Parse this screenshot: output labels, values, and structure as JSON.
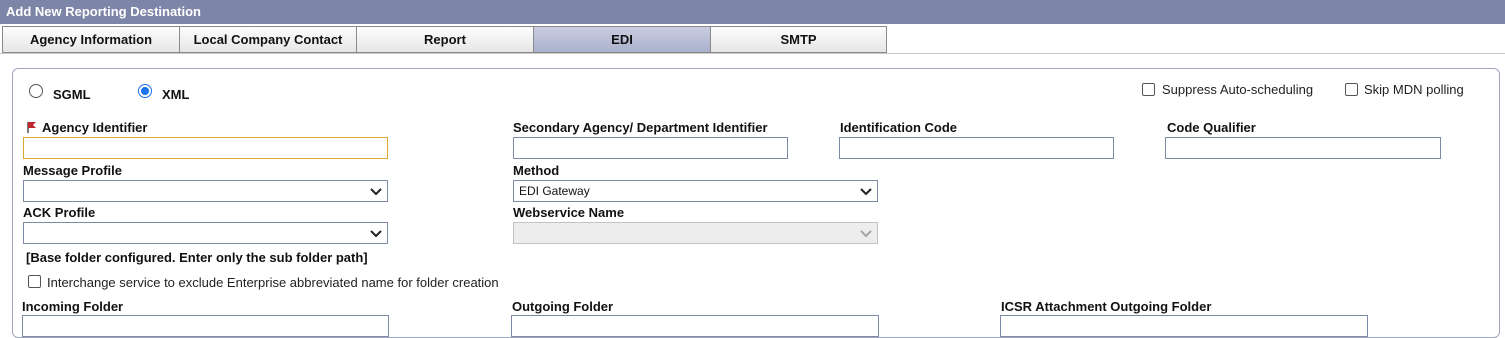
{
  "window": {
    "title": "Add New Reporting Destination"
  },
  "tabs": [
    {
      "label": "Agency Information"
    },
    {
      "label": "Local Company Contact"
    },
    {
      "label": "Report"
    },
    {
      "label": "EDI"
    },
    {
      "label": "SMTP"
    }
  ],
  "format": {
    "sgml_label": "SGML",
    "xml_label": "XML",
    "selected": "XML"
  },
  "options": {
    "suppress_label": "Suppress Auto-scheduling",
    "skip_mdn_label": "Skip MDN polling",
    "interchange_label": "Interchange service to exclude Enterprise abbreviated name for folder creation"
  },
  "fields": {
    "agency_identifier": {
      "label": "Agency Identifier",
      "value": ""
    },
    "secondary_agency": {
      "label": "Secondary Agency/ Department Identifier",
      "value": ""
    },
    "identification_code": {
      "label": "Identification Code",
      "value": ""
    },
    "code_qualifier": {
      "label": "Code Qualifier",
      "value": ""
    },
    "message_profile": {
      "label": "Message Profile",
      "value": ""
    },
    "method": {
      "label": "Method",
      "value": "EDI Gateway"
    },
    "ack_profile": {
      "label": "ACK Profile",
      "value": ""
    },
    "webservice_name": {
      "label": "Webservice Name",
      "value": ""
    },
    "base_folder_note": "[Base folder configured. Enter only the sub folder path]",
    "incoming_folder": {
      "label": "Incoming Folder",
      "value": ""
    },
    "outgoing_folder": {
      "label": "Outgoing Folder",
      "value": ""
    },
    "icsr_folder": {
      "label": "ICSR Attachment Outgoing Folder",
      "value": ""
    }
  },
  "icons": {
    "required": "required-flag-icon",
    "dropdown": "chevron-down-icon"
  },
  "colors": {
    "titlebar": "#7d86a8",
    "active_tab": "#aab1cc",
    "radio_selected": "#1a73e8",
    "required_border": "#e0a530",
    "required_flag": "#c0262d"
  }
}
